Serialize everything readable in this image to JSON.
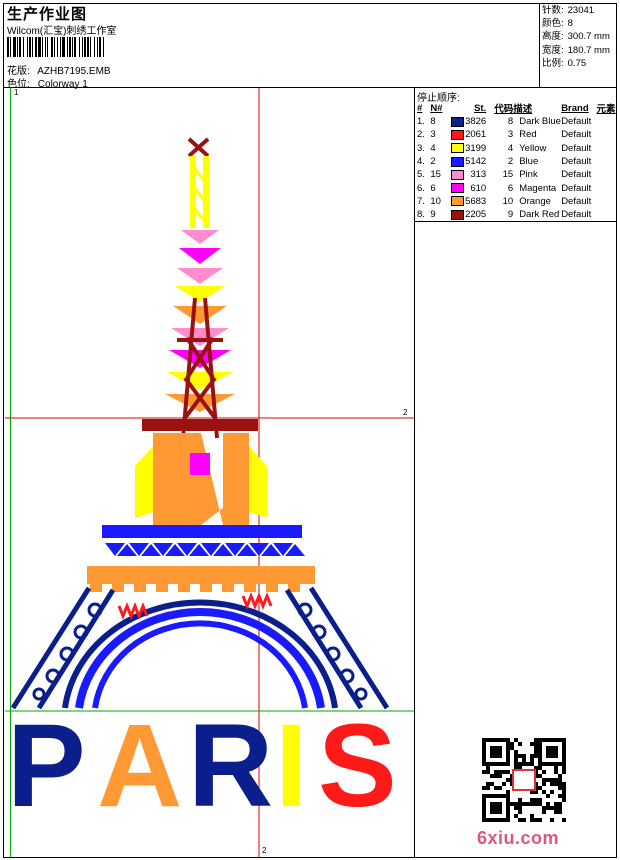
{
  "header": {
    "title": "生产作业图",
    "subtitle": "Wilcom(汇宝)刺绣工作室",
    "pattern_label": "花版:",
    "pattern_value": "AZHB7195.EMB",
    "colorway_label": "色位:",
    "colorway_value": "Colorway 1"
  },
  "stats": [
    {
      "label": "针数:",
      "value": "23041"
    },
    {
      "label": "颜色:",
      "value": "8"
    },
    {
      "label": "高度:",
      "value": "300.7 mm"
    },
    {
      "label": "宽度:",
      "value": "180.7 mm"
    },
    {
      "label": "比例:",
      "value": "0.75"
    }
  ],
  "stop_sequence": {
    "title": "停止顺序:",
    "columns": [
      "#",
      "N#",
      "St.",
      "代码",
      "描述",
      "Brand",
      "元素"
    ],
    "rows": [
      {
        "idx": "1.",
        "n": "8",
        "st": "3826",
        "code": "8",
        "desc": "Dark Blue",
        "brand": "Default",
        "color": "#0a1e8c"
      },
      {
        "idx": "2.",
        "n": "3",
        "st": "2061",
        "code": "3",
        "desc": "Red",
        "brand": "Default",
        "color": "#ff1a1a"
      },
      {
        "idx": "3.",
        "n": "4",
        "st": "3199",
        "code": "4",
        "desc": "Yellow",
        "brand": "Default",
        "color": "#ffff00"
      },
      {
        "idx": "4.",
        "n": "2",
        "st": "5142",
        "code": "2",
        "desc": "Blue",
        "brand": "Default",
        "color": "#1a1aff"
      },
      {
        "idx": "5.",
        "n": "15",
        "st": "313",
        "code": "15",
        "desc": "Pink",
        "brand": "Default",
        "color": "#ff8ccc"
      },
      {
        "idx": "6.",
        "n": "6",
        "st": "610",
        "code": "6",
        "desc": "Magenta",
        "brand": "Default",
        "color": "#ff00ff"
      },
      {
        "idx": "7.",
        "n": "10",
        "st": "5683",
        "code": "10",
        "desc": "Orange",
        "brand": "Default",
        "color": "#ff9933"
      },
      {
        "idx": "8.",
        "n": "9",
        "st": "2205",
        "code": "9",
        "desc": "Dark Red",
        "brand": "Default",
        "color": "#991111"
      }
    ]
  },
  "design": {
    "text": "PARIS",
    "guide_labels": {
      "v1": "1",
      "h2": "2",
      "bottom2": "2"
    }
  },
  "watermark": "6xiu.com"
}
